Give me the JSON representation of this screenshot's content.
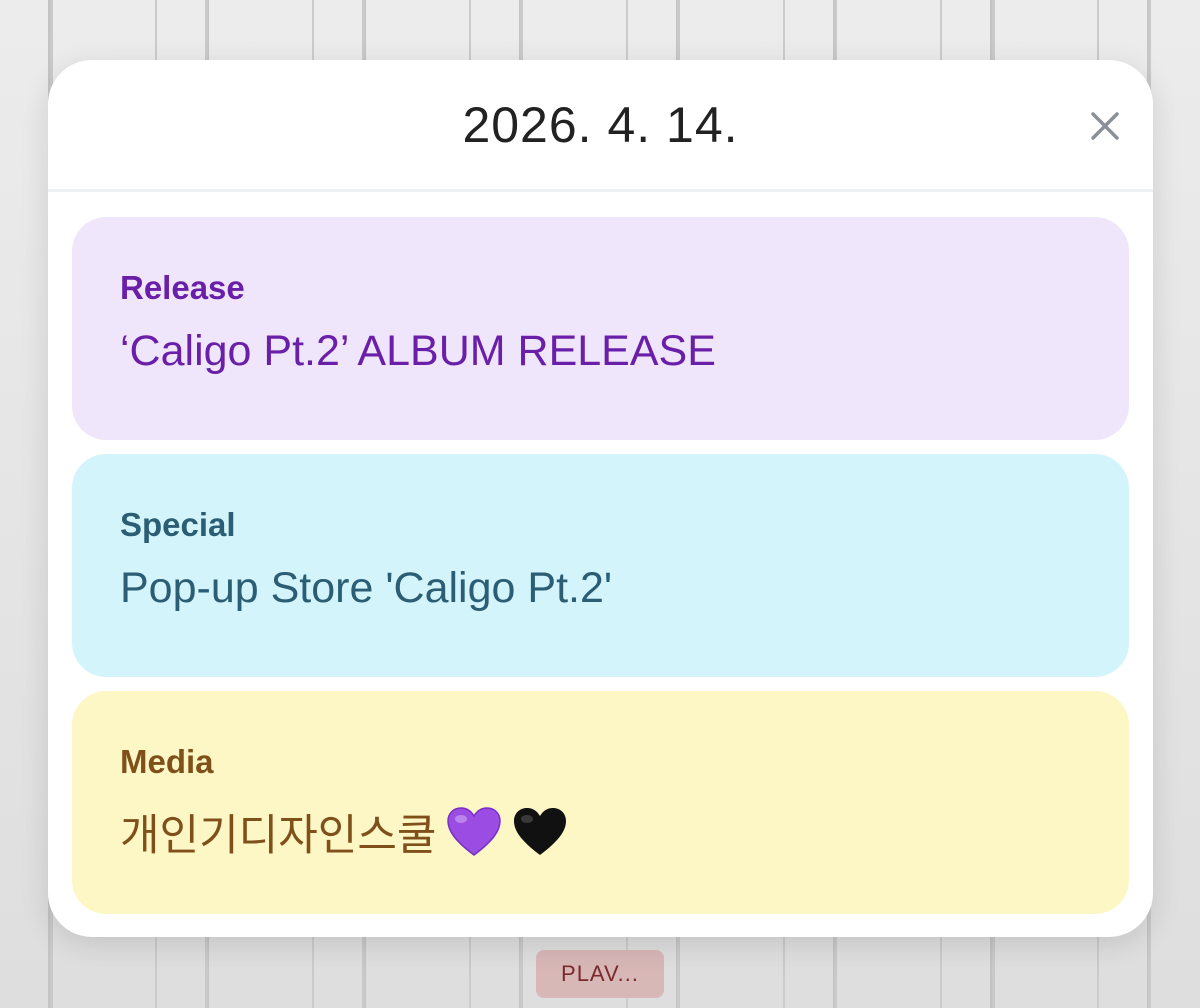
{
  "modal": {
    "date_title": "2026. 4. 14.",
    "close_label": "×"
  },
  "events": [
    {
      "category": "Release",
      "title": "‘Caligo Pt.2’ ALBUM RELEASE",
      "color": "#6a1fa8",
      "background": "#f0e6fb"
    },
    {
      "category": "Special",
      "title": "Pop-up Store 'Caligo Pt.2'",
      "color": "#2b5e74",
      "background": "#d4f4fb"
    },
    {
      "category": "Media",
      "title": "개인기디자인스쿨",
      "emoji": [
        "purple-heart-icon",
        "black-heart-icon"
      ],
      "color": "#80501b",
      "background": "#fdf7c6"
    }
  ],
  "background_calendar": {
    "tag_label": "PLAV..."
  }
}
